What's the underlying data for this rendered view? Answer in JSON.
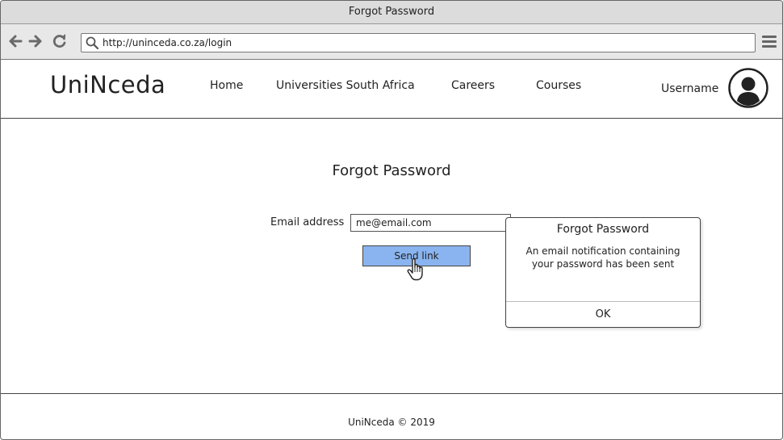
{
  "window": {
    "title": "Forgot Password"
  },
  "browser": {
    "url": "http://uninceda.co.za/login",
    "back_icon": "arrow-left-icon",
    "forward_icon": "arrow-right-icon",
    "reload_icon": "reload-icon",
    "menu_icon": "hamburger-menu-icon"
  },
  "header": {
    "logo": "UniNceda",
    "nav": [
      {
        "label": "Home"
      },
      {
        "label": "Universities South Africa"
      },
      {
        "label": "Careers"
      },
      {
        "label": "Courses"
      }
    ],
    "username": "Username",
    "avatar_icon": "user-avatar-icon"
  },
  "main": {
    "title": "Forgot Password",
    "email_label": "Email address",
    "email_value": "me@email.com",
    "send_button": "Send link"
  },
  "dialog": {
    "title": "Forgot Password",
    "message": "An email notification containing your password has been sent",
    "ok_label": "OK"
  },
  "footer": {
    "text": "UniNceda © 2019"
  },
  "colors": {
    "accent": "#8ab4ef",
    "titlebar": "#dcdcdc",
    "toolbar": "#e8e8e8"
  }
}
